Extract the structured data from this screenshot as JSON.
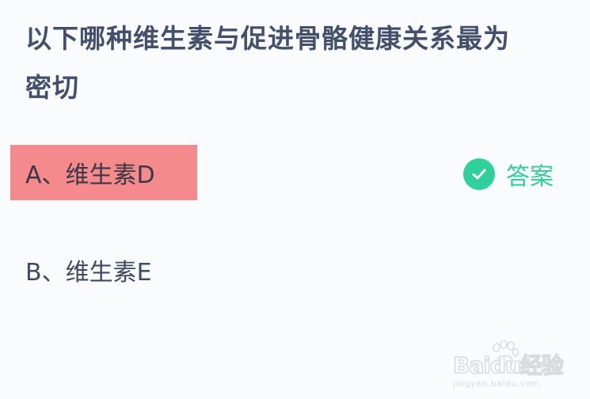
{
  "question": {
    "line1": "以下哪种维生素与促进骨骼健康关系最为",
    "line2": "密切"
  },
  "options": [
    {
      "label": "A、维生素D",
      "selected": true
    },
    {
      "label": "B、维生素E",
      "selected": false
    }
  ],
  "answer": {
    "label": "答案",
    "icon": "check-circle-icon"
  },
  "watermark": {
    "logo": "Baidu经验",
    "url": "jingyan.baidu.com"
  },
  "colors": {
    "question_text": "#434f6b",
    "selected_bg": "#f48a8c",
    "answer_green": "#2fd09a"
  }
}
